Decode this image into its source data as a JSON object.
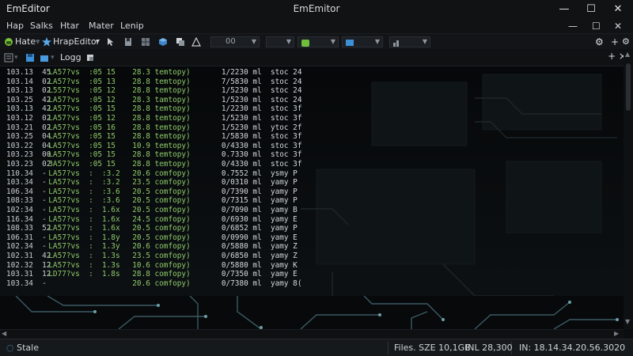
{
  "window": {
    "app_name": "EmEditor",
    "title": "EmEmitor",
    "controls": {
      "minimize": "—",
      "maximize": "☐",
      "close": "✕"
    },
    "sub_controls": {
      "restore": "—",
      "maximize": "☐",
      "close": "✕"
    }
  },
  "menu": [
    "Hap",
    "Salks",
    "Htar",
    "Mater",
    "Lenip"
  ],
  "toolbar": {
    "home_label": "Hate",
    "editor_label": "HrapEditor",
    "dropdown_value": "00",
    "right_icons": [
      "gear-icon",
      "plus-icon",
      "gear-icon"
    ]
  },
  "toolbar2": {
    "logs_label": "Logg",
    "tabs_label": "+ ×"
  },
  "editor": {
    "lines": [
      {
        "ln": "103.13  45",
        "a": "  LA57?vs  :05 15",
        "b": "  28.3 temtopy)",
        "c": "      1/2230 ml  stoc 24"
      },
      {
        "ln": "103.14  02",
        "a": "  LA57?vs  :05 13",
        "b": "  28.8 temtopy)",
        "c": "      7/5830 ml  stoc 24"
      },
      {
        "ln": "103.13  02",
        "a": "  L557?vs  :05 12",
        "b": "  28.8 temtopy)",
        "c": "      1/5230 ml  stoc 24"
      },
      {
        "ln": "103.25  42",
        "a": "  LA57?vs  :05 12",
        "b": "  28.3 tamtopy)",
        "c": "      1/5230 ml  stoc 24"
      },
      {
        "ln": "103.13  42",
        "a": "  LA57?vs  :05 15",
        "b": "  28.8 temtopy)",
        "c": "      1/2230 ml  stoc 3f"
      },
      {
        "ln": "103.12  02",
        "a": "  LA57?vs  :05 12",
        "b": "  28.8 temtopy)",
        "c": "      1/5230 ml  stoc 3f"
      },
      {
        "ln": "103.21  02",
        "a": "  LA57?vs  :05 16",
        "b": "  28.8 temtopy)",
        "c": "      1/5230 ml  ytoc 2f"
      },
      {
        "ln": "103.25  04",
        "a": "  LA57?vs  :05 15",
        "b": "  28.8 temtopy)",
        "c": "      1/5830 ml  stoc 3f"
      },
      {
        "ln": "103.22  04",
        "a": "  LA57?vs  :05 15",
        "b": "  10.9 temtopy)",
        "c": "      0/4330 ml  stoc 3f"
      },
      {
        "ln": "103.23  00",
        "a": "  LA57?vs  :05 15",
        "b": "  28.8 temtopy)",
        "c": "      0.7330 ml  stoc 3f"
      },
      {
        "ln": "103.23  02",
        "a": "  3A57?vs  :05 15",
        "b": "  28.8 temtopy)",
        "c": "      0/4330 ml  stoc 3f"
      },
      {
        "ln": "110.34  -",
        "a": "  LA57?vs  :  :3.2",
        "b": "  20.6 comfopy)",
        "c": "      0.7552 ml  ysmy P"
      },
      {
        "ln": "103.34  -",
        "a": "  LA57?vs  :  :3.2",
        "b": "  23.5 comfopy)",
        "c": "      0/0310 ml  yamy P"
      },
      {
        "ln": "106.34  -",
        "a": "  LA57?vs  :  :3.6",
        "b": "  20.5 comfopy)",
        "c": "      0/7390 ml  yamy P"
      },
      {
        "ln": "108:33  -",
        "a": "  LA57?vs  :  :3.6",
        "b": "  20.5 comfopy)",
        "c": "      0/7315 ml  yamy P"
      },
      {
        "ln": "102:34  -",
        "a": "  LA57?vs  :  1.6x",
        "b": "  20.5 comfopy)",
        "c": "      0/7090 ml  yamy B"
      },
      {
        "ln": "116.34  -",
        "a": "  LA57?vs  :  1.6x",
        "b": "  24.5 comfopy)",
        "c": "      0/6930 ml  yamy E"
      },
      {
        "ln": "108.33  52",
        "a": "  LA57?vs  :  1.6x",
        "b": "  20.5 comfopy)",
        "c": "      0/6852 ml  yamy P"
      },
      {
        "ln": "106.31  -",
        "a": "  LA57?vs  :  1.8y",
        "b": "  20.5 comfopy)",
        "c": "      0/0990 ml  yamy E"
      },
      {
        "ln": "102.34  -",
        "a": "  LA57?vs  :  1.3y",
        "b": "  20.6 comfopy)",
        "c": "      0/5880 ml  yamy Z"
      },
      {
        "ln": "102.31  42",
        "a": "  LA57?vs  :  1.3s",
        "b": "  23.5 comfopy)",
        "c": "      0/6850 ml  yamy Z"
      },
      {
        "ln": "102.32  12",
        "a": "  LA57?vs  :  1.3s",
        "b": "  10.6 comfopy)",
        "c": "      0/5880 ml  yamy K"
      },
      {
        "ln": "103.31  12",
        "a": "  LD77?vs  :  1.8s",
        "b": "  28.8 comfopy)",
        "c": "      0/7350 ml  yamy E"
      },
      {
        "ln": "103.34  -",
        "a": "",
        "b": "  20.6 comfopy)",
        "c": "      0/7380 ml  yamy 8("
      }
    ]
  },
  "status": {
    "left": "Stale",
    "files": "Files. SZE 10,1GB",
    "inl": "INL 28,300",
    "in": "IN: 18.14.34.20.56.3020"
  }
}
